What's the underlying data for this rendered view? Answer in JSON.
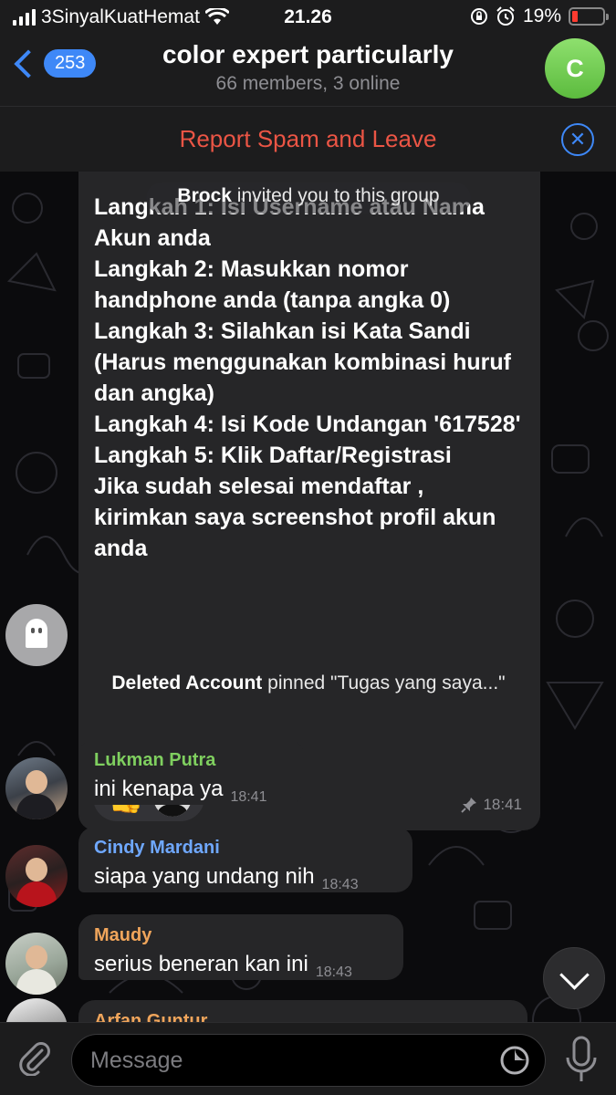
{
  "status_bar": {
    "carrier": "3SinyalKuatHemat",
    "time": "21.26",
    "battery": "19%"
  },
  "header": {
    "back_badge": "253",
    "title": "color expert particularly",
    "subtitle": "66 members, 3 online",
    "avatar_letter": "C"
  },
  "spam_bar": {
    "label": "Report Spam and Leave"
  },
  "service": {
    "invite_name": "Brock",
    "invite_text": " invited you to this group",
    "pin_name": "Deleted Account",
    "pin_text": " pinned \"Tugas yang saya...\""
  },
  "pinned_message": {
    "text": "Langkah 1: Isi Username atau Nama Akun anda\nLangkah 2: Masukkan nomor handphone anda (tanpa angka 0)\nLangkah 3: Silahkan isi Kata Sandi (Harus menggunakan kombinasi huruf dan angka)\nLangkah 4: Isi Kode Undangan '617528'\nLangkah 5: Klik Daftar/Registrasi\nJika sudah selesai mendaftar , kirimkan saya screenshot profil akun anda",
    "time": "18:41"
  },
  "messages": [
    {
      "sender": "Lukman Putra",
      "text": "ini kenapa ya",
      "time": "18:41",
      "color": "#7fcf5f"
    },
    {
      "sender": "Cindy Mardani",
      "text": "siapa yang undang nih",
      "time": "18:43",
      "color": "#6fa8ff"
    },
    {
      "sender": "Maudy",
      "text": "serius beneran kan ini",
      "time": "18:43",
      "color": "#f0a55b"
    },
    {
      "sender": "Arfan Guntur",
      "text": "",
      "time": "",
      "color": "#f0a55b"
    }
  ],
  "input": {
    "placeholder": "Message"
  },
  "colors": {
    "accent": "#3e88f7",
    "danger": "#eb5545",
    "bubble": "#262628"
  },
  "icons": [
    "signal-icon",
    "wifi-icon",
    "orientation-lock-icon",
    "alarm-icon",
    "battery-icon",
    "back-chevron-icon",
    "close-icon",
    "pin-icon",
    "thumbs-up-icon",
    "attach-icon",
    "sticker-icon",
    "mic-icon",
    "chevron-down-icon"
  ]
}
